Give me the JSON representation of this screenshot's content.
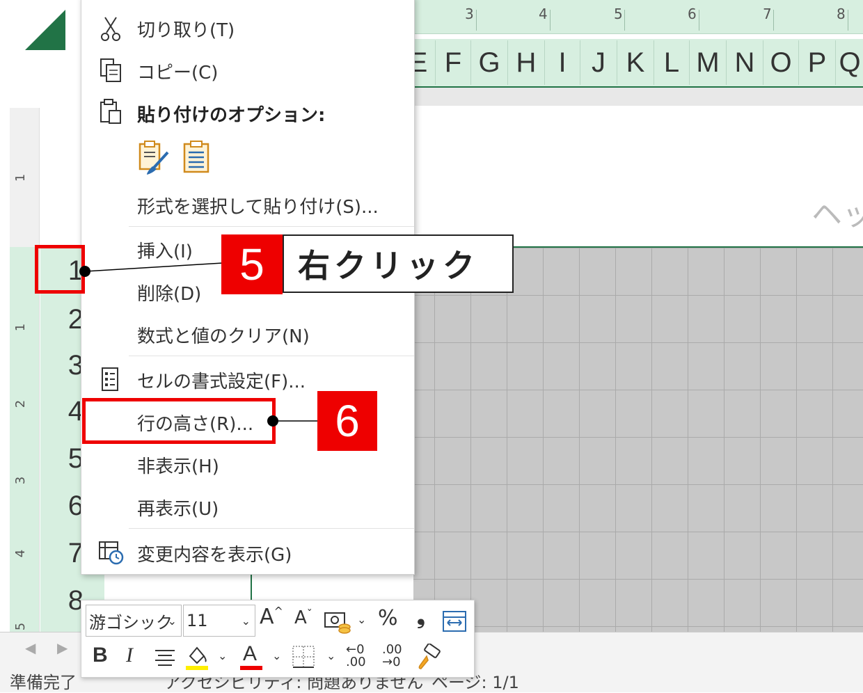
{
  "ruler": {
    "top_numbers": [
      "3",
      "4",
      "5",
      "6",
      "7",
      "8"
    ],
    "left_numbers": [
      "1",
      "1",
      "2",
      "3",
      "4",
      "5"
    ]
  },
  "columns": [
    "E",
    "F",
    "G",
    "H",
    "I",
    "J",
    "K",
    "L",
    "M",
    "N",
    "O",
    "P",
    "Q"
  ],
  "rows": [
    "1",
    "2",
    "3",
    "4",
    "5",
    "6",
    "7",
    "8"
  ],
  "header_area_text": "ヘッ",
  "context_menu": {
    "cut": "切り取り(T)",
    "copy": "コピー(C)",
    "paste_options_label": "貼り付けのオプション:",
    "paste_special": "形式を選択して貼り付け(S)...",
    "insert": "挿入(I)",
    "delete": "削除(D)",
    "clear_contents": "数式と値のクリア(N)",
    "format_cells": "セルの書式設定(F)...",
    "row_height": "行の高さ(R)...",
    "hide": "非表示(H)",
    "unhide": "再表示(U)",
    "show_changes": "変更内容を表示(G)"
  },
  "callouts": {
    "step5_number": "5",
    "step5_text": "右クリック",
    "step6_number": "6"
  },
  "mini_toolbar": {
    "font_name": "游ゴシック",
    "font_size": "11",
    "percent": "%",
    "comma": "❟",
    "bold": "B",
    "italic": "I",
    "font_color_letter": "A",
    "decrease_decimal": "←0 .00",
    "increase_decimal": ".00 →0"
  },
  "status_bar": {
    "ready": "準備完了",
    "accessibility": "アクセシビリティ: 問題ありません",
    "page": "ページ: 1/1"
  },
  "colors": {
    "excel_green": "#217346",
    "header_green": "#d7efe0",
    "callout_red": "#ee0000",
    "grid_gray": "#c8c8c8"
  }
}
